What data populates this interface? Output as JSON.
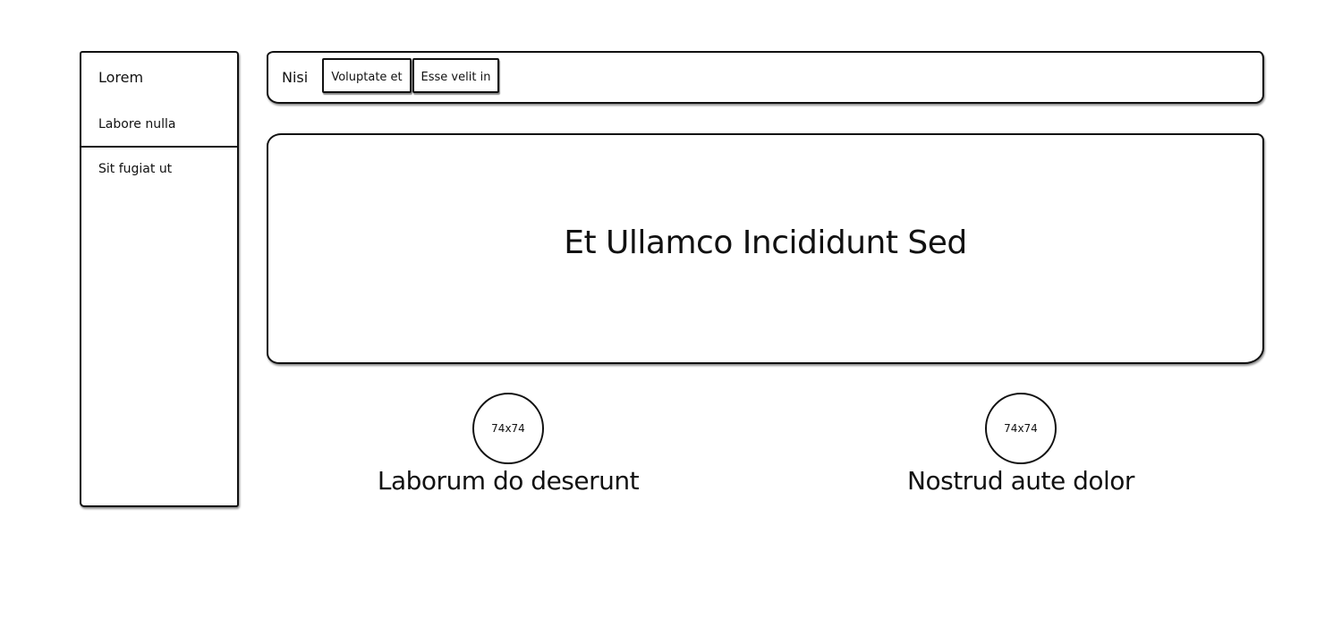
{
  "sidebar": {
    "title": "Lorem",
    "items": [
      {
        "label": "Labore nulla"
      },
      {
        "label": "Sit fugiat ut"
      }
    ]
  },
  "navbar": {
    "brand": "Nisi",
    "tabs": [
      {
        "label": "Voluptate et"
      },
      {
        "label": "Esse velit in"
      }
    ]
  },
  "hero": {
    "title": "Et Ullamco Incididunt Sed"
  },
  "features": [
    {
      "avatar_text": "74x74",
      "label": "Laborum do deserunt"
    },
    {
      "avatar_text": "74x74",
      "label": "Nostrud aute dolor"
    }
  ]
}
